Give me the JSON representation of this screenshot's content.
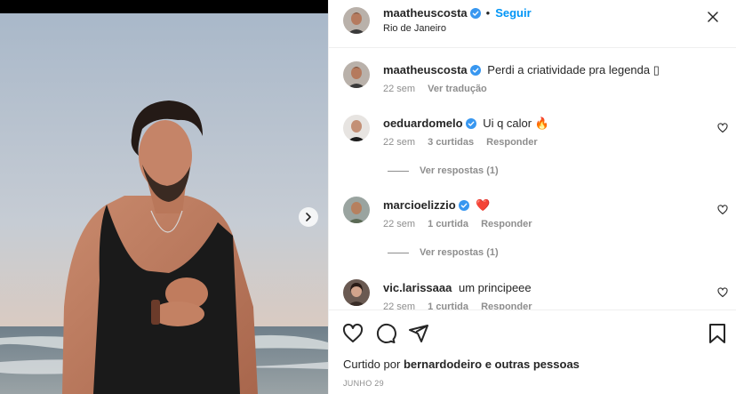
{
  "post": {
    "username": "maatheuscosta",
    "follow_label": "Seguir",
    "dot": "•",
    "location": "Rio de Janeiro"
  },
  "caption": {
    "username": "maatheuscosta",
    "text": "Perdi a criatividade pra legenda ▯",
    "time": "22 sem",
    "translate_label": "Ver tradução"
  },
  "comments": [
    {
      "username": "oeduardomelo",
      "text": "Ui q calor 🔥",
      "time": "22 sem",
      "likes": "3 curtidas",
      "reply_label": "Responder",
      "replies_label": "Ver respostas (1)"
    },
    {
      "username": "marcioelizzio",
      "text": "❤️",
      "time": "22 sem",
      "likes": "1 curtida",
      "reply_label": "Responder",
      "replies_label": "Ver respostas (1)"
    },
    {
      "username": "vic.larissaaa",
      "text": "um principeee",
      "time": "22 sem",
      "likes": "1 curtida",
      "reply_label": "Responder"
    }
  ],
  "footer": {
    "liked_by_prefix": "Curtido por",
    "liked_by_user": "bernardodeiro",
    "liked_by_suffix": "e outras pessoas",
    "date": "JUNHO 29"
  },
  "icons": {
    "heart": "heart-icon",
    "comment": "comment-icon",
    "share": "share-icon",
    "save": "bookmark-icon",
    "more": "more-options-icon",
    "next": "chevron-right-icon",
    "verified": "verified-badge-icon"
  },
  "colors": {
    "follow_blue": "#0095f6",
    "verified_blue": "#3897f0",
    "secondary_text": "#8e8e8e",
    "border": "#efefef"
  }
}
